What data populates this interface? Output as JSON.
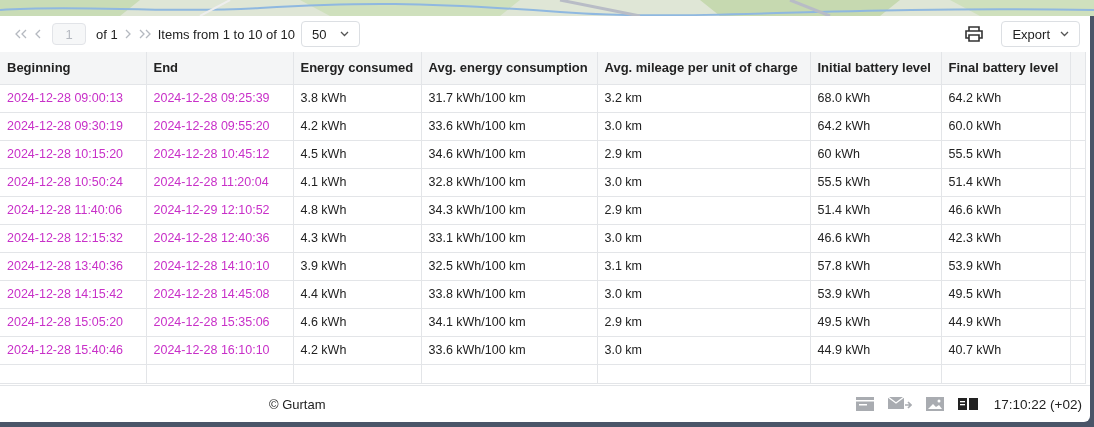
{
  "pager": {
    "page": "1",
    "of": "of 1",
    "items": "Items from 1 to 10 of 10",
    "page_size": "50"
  },
  "export": "Export",
  "table": {
    "columns": [
      "Beginning",
      "End",
      "Energy consumed",
      "Avg. energy consumption",
      "Avg. mileage per unit of charge",
      "Initial battery level",
      "Final battery level"
    ],
    "rows": [
      [
        "2024-12-28 09:00:13",
        "2024-12-28 09:25:39",
        "3.8 kWh",
        "31.7 kWh/100 km",
        "3.2 km",
        "68.0 kWh",
        "64.2 kWh"
      ],
      [
        "2024-12-28 09:30:19",
        "2024-12-28 09:55:20",
        "4.2 kWh",
        "33.6 kWh/100 km",
        "3.0 km",
        "64.2 kWh",
        "60.0 kWh"
      ],
      [
        "2024-12-28 10:15:20",
        "2024-12-28 10:45:12",
        "4.5 kWh",
        "34.6 kWh/100 km",
        "2.9 km",
        "60 kWh",
        "55.5 kWh"
      ],
      [
        "2024-12-28 10:50:24",
        "2024-12-28 11:20:04",
        "4.1 kWh",
        "32.8 kWh/100 km",
        "3.0 km",
        "55.5 kWh",
        "51.4 kWh"
      ],
      [
        "2024-12-28 11:40:06",
        "2024-12-29 12:10:52",
        "4.8 kWh",
        "34.3 kWh/100 km",
        "2.9 km",
        "51.4 kWh",
        "46.6 kWh"
      ],
      [
        "2024-12-28 12:15:32",
        "2024-12-28 12:40:36",
        "4.3 kWh",
        "33.1 kWh/100 km",
        "3.0 km",
        "46.6 kWh",
        "42.3 kWh"
      ],
      [
        "2024-12-28 13:40:36",
        "2024-12-28 14:10:10",
        "3.9 kWh",
        "32.5 kWh/100 km",
        "3.1 km",
        "57.8 kWh",
        "53.9 kWh"
      ],
      [
        "2024-12-28 14:15:42",
        "2024-12-28 14:45:08",
        "4.4 kWh",
        "33.8 kWh/100 km",
        "3.0 km",
        "53.9 kWh",
        "49.5 kWh"
      ],
      [
        "2024-12-28 15:05:20",
        "2024-12-28 15:35:06",
        "4.6 kWh",
        "34.1 kWh/100 km",
        "2.9 km",
        "49.5 kWh",
        "44.9 kWh"
      ],
      [
        "2024-12-28 15:40:46",
        "2024-12-28 16:10:10",
        "4.2 kWh",
        "33.6 kWh/100 km",
        "3.0 km",
        "44.9 kWh",
        "40.7 kWh"
      ]
    ]
  },
  "footer": {
    "copyright": "© Gurtam",
    "time": "17:10:22 (+02)"
  }
}
